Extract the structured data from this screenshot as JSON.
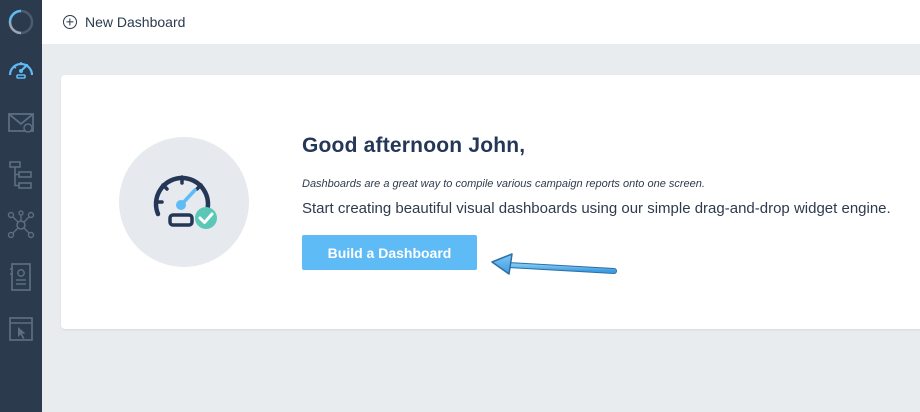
{
  "topbar": {
    "new_dashboard_label": "New Dashboard",
    "new_dashboard_icon": "plus-circle-icon"
  },
  "sidebar": {
    "items": [
      {
        "icon": "loading-ring-logo"
      },
      {
        "icon": "speedometer-icon",
        "active": true
      },
      {
        "icon": "email-icon"
      },
      {
        "icon": "hierarchy-icon"
      },
      {
        "icon": "network-icon"
      },
      {
        "icon": "contact-card-icon"
      },
      {
        "icon": "window-cursor-icon"
      }
    ]
  },
  "welcome": {
    "greeting": "Good afternoon John,",
    "subtitle_italic": "Dashboards are a great way to compile various campaign reports onto one screen.",
    "subtitle_main": "Start creating beautiful visual dashboards using our simple drag-and-drop widget engine.",
    "cta_label": "Build a Dashboard"
  },
  "colors": {
    "sidebar_bg": "#2b3a4d",
    "page_bg": "#e9ecef",
    "accent": "#5ebbf5",
    "heading": "#253757",
    "check": "#5bc7b7"
  }
}
